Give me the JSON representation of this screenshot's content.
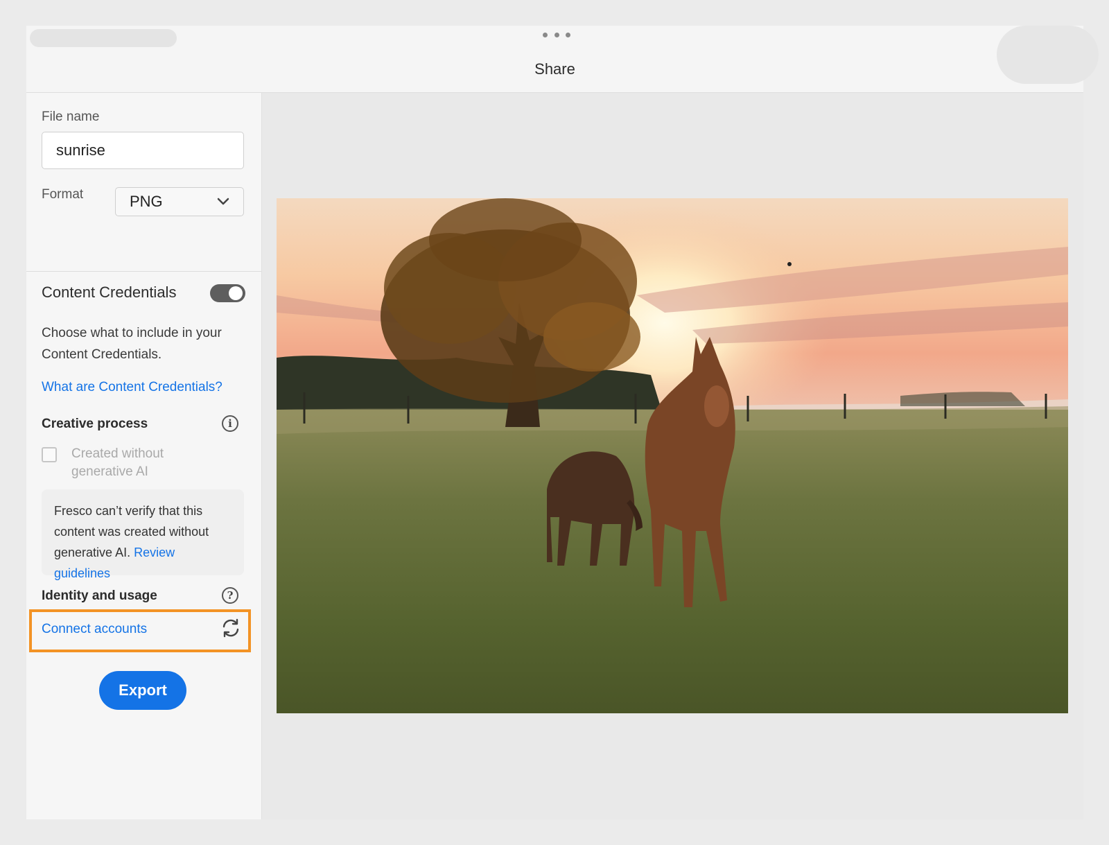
{
  "header": {
    "title": "Share"
  },
  "sidebar": {
    "file_name": {
      "label": "File name",
      "value": "sunrise"
    },
    "format": {
      "label": "Format",
      "selected": "PNG"
    },
    "content_credentials": {
      "title": "Content Credentials",
      "toggle_on": true,
      "description": "Choose what to include in your Content Credentials.",
      "learn_link": "What are Content Credentials?"
    },
    "creative_process": {
      "title": "Creative process",
      "checkbox_label": "Created without generative AI",
      "checked": false,
      "notice_text": "Fresco can’t verify that this content was created without generative AI.",
      "notice_link": "Review guidelines"
    },
    "identity": {
      "title": "Identity and usage",
      "connect_link": "Connect accounts"
    },
    "export_label": "Export"
  },
  "colors": {
    "accent": "#1473e6",
    "highlight": "#f39325",
    "toggle": "#5e5e5e"
  },
  "icons": {
    "more": "more-horizontal-icon",
    "chevron": "chevron-down-icon",
    "info": "info-icon",
    "help": "help-icon",
    "sync": "sync-icon"
  }
}
